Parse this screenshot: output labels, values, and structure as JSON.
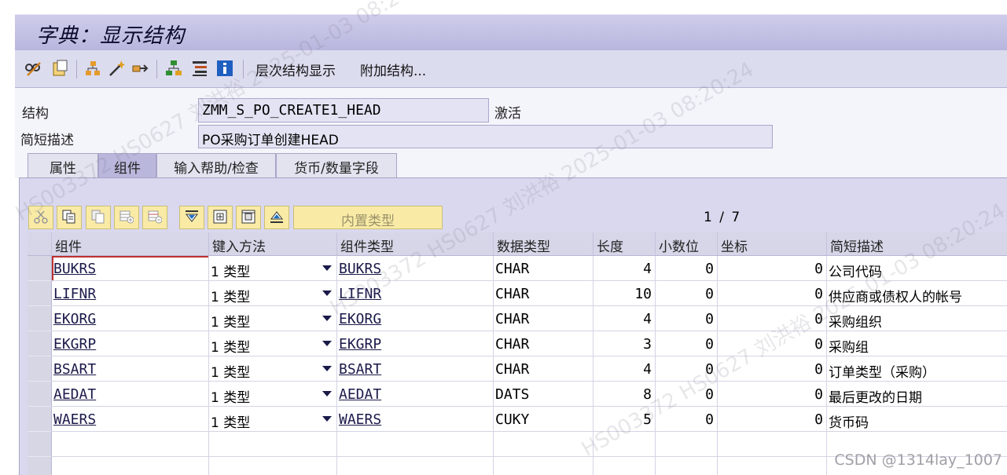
{
  "window": {
    "title": "字典：显示结构"
  },
  "toolbar": {
    "icons": [
      "glasses-pencil-icon",
      "clipboard-icon",
      "hierarchy-icon",
      "magic-wand-icon",
      "pipe-icon",
      "org-chart-icon",
      "list-lines-icon",
      "info-icon"
    ],
    "hierarchy_label": "层次结构显示",
    "append_label": "附加结构..."
  },
  "form": {
    "structure_label": "结构",
    "structure_value": "ZMM_S_PO_CREATE1_HEAD",
    "status": "激活",
    "short_desc_label": "简短描述",
    "short_desc_value": "PO采购订单创建HEAD"
  },
  "tabs": [
    {
      "label": "属性"
    },
    {
      "label": "组件"
    },
    {
      "label": "输入帮助/检查"
    },
    {
      "label": "货币/数量字段"
    }
  ],
  "table_toolbar": {
    "builtin_type_label": "内置类型",
    "pager": "1 / 7"
  },
  "columns": [
    "组件",
    "键入方法",
    "组件类型",
    "数据类型",
    "长度",
    "小数位",
    "坐标",
    "简短描述"
  ],
  "rows": [
    {
      "component": "BUKRS",
      "entry": "1 类型",
      "comptype": "BUKRS",
      "dtype": "CHAR",
      "length": "4",
      "decimals": "0",
      "coord": "0",
      "desc": "公司代码"
    },
    {
      "component": "LIFNR",
      "entry": "1 类型",
      "comptype": "LIFNR",
      "dtype": "CHAR",
      "length": "10",
      "decimals": "0",
      "coord": "0",
      "desc": "供应商或债权人的帐号"
    },
    {
      "component": "EKORG",
      "entry": "1 类型",
      "comptype": "EKORG",
      "dtype": "CHAR",
      "length": "4",
      "decimals": "0",
      "coord": "0",
      "desc": "采购组织"
    },
    {
      "component": "EKGRP",
      "entry": "1 类型",
      "comptype": "EKGRP",
      "dtype": "CHAR",
      "length": "3",
      "decimals": "0",
      "coord": "0",
      "desc": "采购组"
    },
    {
      "component": "BSART",
      "entry": "1 类型",
      "comptype": "BSART",
      "dtype": "CHAR",
      "length": "4",
      "decimals": "0",
      "coord": "0",
      "desc": "订单类型（采购）"
    },
    {
      "component": "AEDAT",
      "entry": "1 类型",
      "comptype": "AEDAT",
      "dtype": "DATS",
      "length": "8",
      "decimals": "0",
      "coord": "0",
      "desc": "最后更改的日期"
    },
    {
      "component": "WAERS",
      "entry": "1 类型",
      "comptype": "WAERS",
      "dtype": "CUKY",
      "length": "5",
      "decimals": "0",
      "coord": "0",
      "desc": "货币码"
    }
  ],
  "watermark": "HS003372 HS0627 刘洪裕 2025-01-03 08:20:24",
  "credit": "CSDN @1314lay_1007"
}
